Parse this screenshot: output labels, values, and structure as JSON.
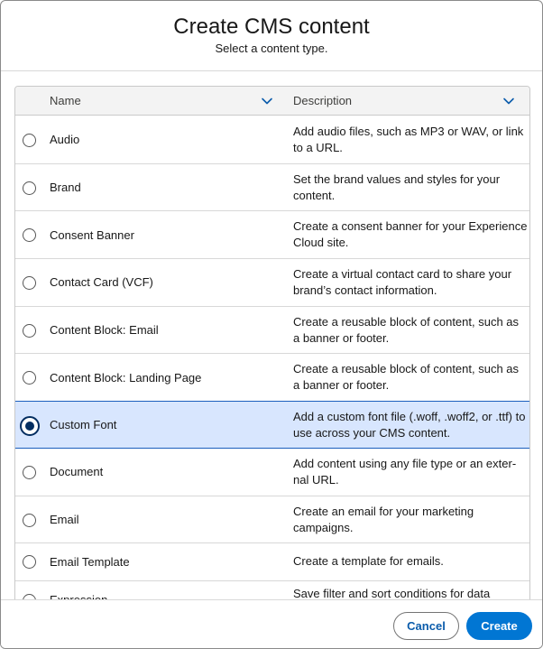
{
  "header": {
    "title": "Create CMS content",
    "subtitle": "Select a content type."
  },
  "table": {
    "columns": [
      {
        "label": "Name",
        "icon": "chevron-down-icon"
      },
      {
        "label": "Description",
        "icon": "chevron-down-icon"
      }
    ],
    "selected_index": 6,
    "rows": [
      {
        "name": "Audio",
        "description": "Add audio files, such as MP3 or WAV, or link to a URL."
      },
      {
        "name": "Brand",
        "description": "Set the brand values and styles for your content."
      },
      {
        "name": "Consent Banner",
        "description": "Create a consent banner for your Experience Cloud site."
      },
      {
        "name": "Contact Card (VCF)",
        "description": "Create a virtual contact card to share your brand’s contact information."
      },
      {
        "name": "Content Block: Email",
        "description": "Create a reusable block of content, such as a banner or footer."
      },
      {
        "name": "Content Block: Landing Page",
        "description": "Create a reusable block of content, such as a banner or footer."
      },
      {
        "name": "Custom Font",
        "description": "Add a custom font file (.woff, .woff2, or .ttf) to use across your CMS content."
      },
      {
        "name": "Document",
        "description": "Add content using any file type or an exter­nal URL."
      },
      {
        "name": "Email",
        "description": "Create an email for your marketing campaigns."
      },
      {
        "name": "Email Template",
        "description": "Create a template for emails."
      },
      {
        "name": "Expression",
        "description": "Save filter and sort conditions for data"
      }
    ]
  },
  "footer": {
    "cancel_label": "Cancel",
    "create_label": "Create"
  },
  "colors": {
    "brand_blue": "#0176d3",
    "selected_row_bg": "#d8e6fe",
    "link_blue": "#0b5cab"
  }
}
